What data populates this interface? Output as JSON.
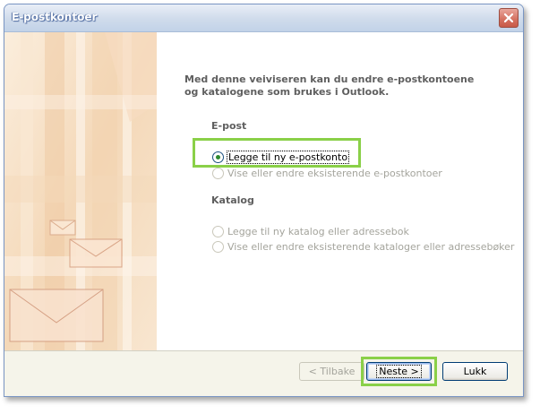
{
  "window": {
    "title": "E-postkontoer"
  },
  "main": {
    "intro_line1": "Med denne veiviseren kan du endre e-postkontoene",
    "intro_line2": "og katalogene som brukes i Outlook.",
    "email_group": {
      "label": "E-post",
      "options": [
        {
          "label": "Legge til ny e-postkonto",
          "selected": true,
          "enabled": true
        },
        {
          "label": "Vise eller endre eksisterende e-postkontoer",
          "selected": false,
          "enabled": false
        }
      ]
    },
    "directory_group": {
      "label": "Katalog",
      "options": [
        {
          "label": "Legge til ny katalog eller adressebok",
          "selected": false,
          "enabled": false
        },
        {
          "label": "Vise eller endre eksisterende kataloger eller adressebøker",
          "selected": false,
          "enabled": false
        }
      ]
    }
  },
  "footer": {
    "back_label": "< Tilbake",
    "next_label": "Neste >",
    "close_label": "Lukk"
  },
  "colors": {
    "highlight": "#8ad048",
    "title_bar": "#cfdbeb",
    "accent_text": "#5f5f5f"
  },
  "icons": [
    "close-icon",
    "envelope-icon"
  ]
}
